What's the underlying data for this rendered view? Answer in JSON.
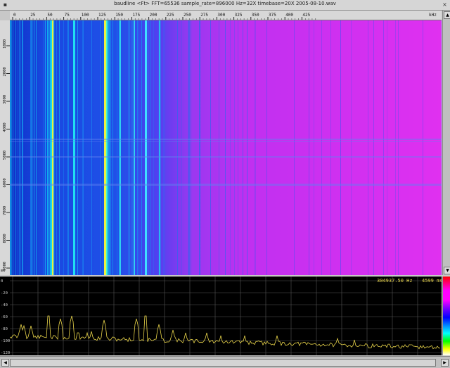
{
  "window": {
    "title": "baudline  <Ft> FFT=65536 sample_rate=896000 Hz=32X timebase=20X  2005-08-10.wav",
    "close_glyph": "×",
    "menu_glyph": "▪"
  },
  "frequency_axis": {
    "unit": "kHz",
    "ticks": [
      "0",
      "25",
      "50",
      "75",
      "100",
      "125",
      "150",
      "175",
      "200",
      "225",
      "250",
      "275",
      "300",
      "325",
      "350",
      "375",
      "400",
      "425"
    ]
  },
  "time_axis": {
    "unit": "ms",
    "ticks": [
      "1000",
      "2000",
      "3000",
      "4000",
      "5000",
      "6000",
      "7000",
      "8000",
      "9000"
    ]
  },
  "spectrum": {
    "frequency_readout": "304937.50 Hz",
    "time_readout": "4599 ms",
    "db_ticks": [
      "0",
      "-20",
      "-40",
      "-60",
      "-80",
      "-100",
      "-120"
    ]
  },
  "scrollbars": {
    "up_arrow": "▲",
    "down_arrow": "▼",
    "left_arrow": "◀",
    "right_arrow": "▶"
  },
  "colors": {
    "waterfall_background": "#e030f0",
    "spectrum_trace": "#e8d44a",
    "grid": "#555555"
  }
}
